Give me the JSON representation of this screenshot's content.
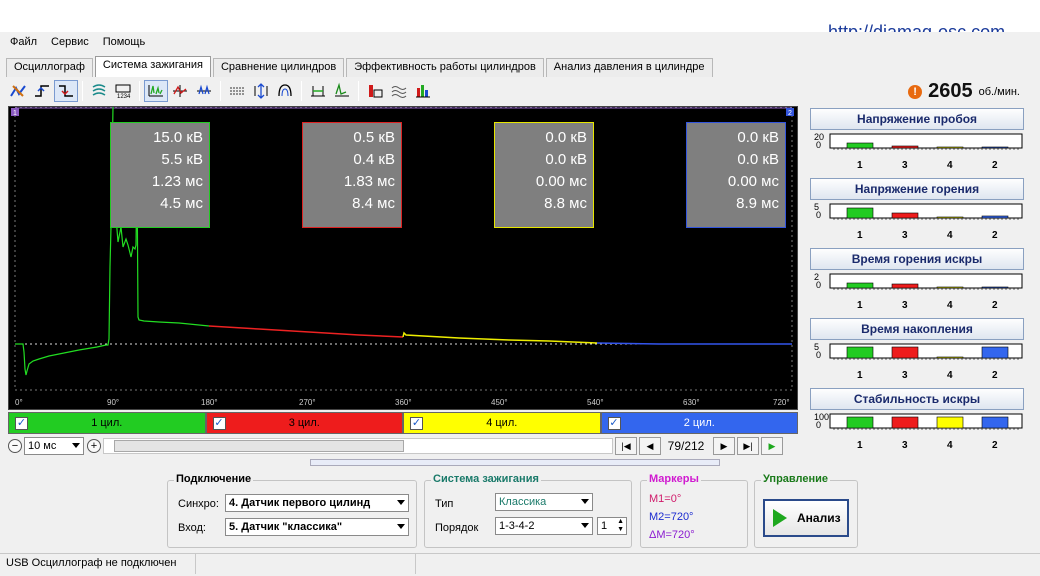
{
  "site_url": "http://diamag-osc.com",
  "menu": [
    "Файл",
    "Сервис",
    "Помощь"
  ],
  "tabs": [
    {
      "label": "Осциллограф",
      "active": false
    },
    {
      "label": "Система зажигания",
      "active": true
    },
    {
      "label": "Сравнение цилиндров",
      "active": false
    },
    {
      "label": "Эффективность работы цилиндров",
      "active": false
    },
    {
      "label": "Анализ давления в цилиндре",
      "active": false
    }
  ],
  "rpm": {
    "value": "2605",
    "unit": "об./мин.",
    "warning_icon": "warning-icon"
  },
  "scope": {
    "markers_top": [
      "1",
      "2"
    ],
    "x_ticks": [
      "0°",
      "90°",
      "180°",
      "270°",
      "360°",
      "450°",
      "540°",
      "630°",
      "720°"
    ],
    "value_boxes": [
      {
        "lines": [
          "15.0 кВ",
          "5.5 кВ",
          "1.23 мс",
          "4.5 мс"
        ],
        "color": "#22cc22"
      },
      {
        "lines": [
          "0.5 кВ",
          "0.4 кВ",
          "1.83 мс",
          "8.4 мс"
        ],
        "color": "#dd2222"
      },
      {
        "lines": [
          "0.0 кВ",
          "0.0 кВ",
          "0.00 мс",
          "8.8 мс"
        ],
        "color": "#e6e600"
      },
      {
        "lines": [
          "0.0 кВ",
          "0.0 кВ",
          "0.00 мс",
          "8.9 мс"
        ],
        "color": "#3355dd"
      }
    ]
  },
  "cylinders": [
    {
      "label": "1 цил.",
      "color": "#22cc22",
      "checked": true
    },
    {
      "label": "3 цил.",
      "color": "#ee1c1c",
      "checked": true
    },
    {
      "label": "4 цил.",
      "color": "#ffff00",
      "checked": true
    },
    {
      "label": "2 цил.",
      "color": "#3366ee",
      "checked": true
    }
  ],
  "nav": {
    "timebase": "10 мс",
    "page": "79/212"
  },
  "right_panel": [
    {
      "title": "Напряжение пробоя",
      "ymax": "20",
      "ymin": "0",
      "labels": [
        "1",
        "3",
        "4",
        "2"
      ],
      "levels": [
        0.45,
        0.2,
        0.05,
        0.05
      ]
    },
    {
      "title": "Напряжение горения",
      "ymax": "5",
      "ymin": "0",
      "labels": [
        "1",
        "3",
        "4",
        "2"
      ],
      "levels": [
        0.8,
        0.4,
        0.05,
        0.15
      ]
    },
    {
      "title": "Время горения искры",
      "ymax": "2",
      "ymin": "0",
      "labels": [
        "1",
        "3",
        "4",
        "2"
      ],
      "levels": [
        0.45,
        0.3,
        0.05,
        0.1
      ]
    },
    {
      "title": "Время накопления",
      "ymax": "5",
      "ymin": "0",
      "labels": [
        "1",
        "3",
        "4",
        "2"
      ],
      "levels": [
        0.9,
        0.9,
        0.05,
        0.9
      ]
    },
    {
      "title": "Стабильность искры",
      "ymax": "100",
      "ymin": "0",
      "labels": [
        "1",
        "3",
        "4",
        "2"
      ],
      "levels": [
        0.95,
        0.95,
        0.95,
        0.95
      ]
    }
  ],
  "connection": {
    "title": "Подключение",
    "sync_label": "Синхро:",
    "sync_value": "4.  Датчик первого цилинд",
    "input_label": "Вход:",
    "input_value": "5.  Датчик \"классика\""
  },
  "ignition": {
    "title": "Система зажигания",
    "type_label": "Тип",
    "type_value": "Классика",
    "order_label": "Порядок",
    "order_value": "1-3-4-2",
    "order_spin": "1"
  },
  "markers": {
    "title": "Маркеры",
    "m1": "M1=0°",
    "m2": "M2=720°",
    "dm": "ΔM=720°"
  },
  "control": {
    "title": "Управление",
    "analyze": "Анализ"
  },
  "status": [
    "USB Осциллограф не подключен",
    "",
    ""
  ]
}
